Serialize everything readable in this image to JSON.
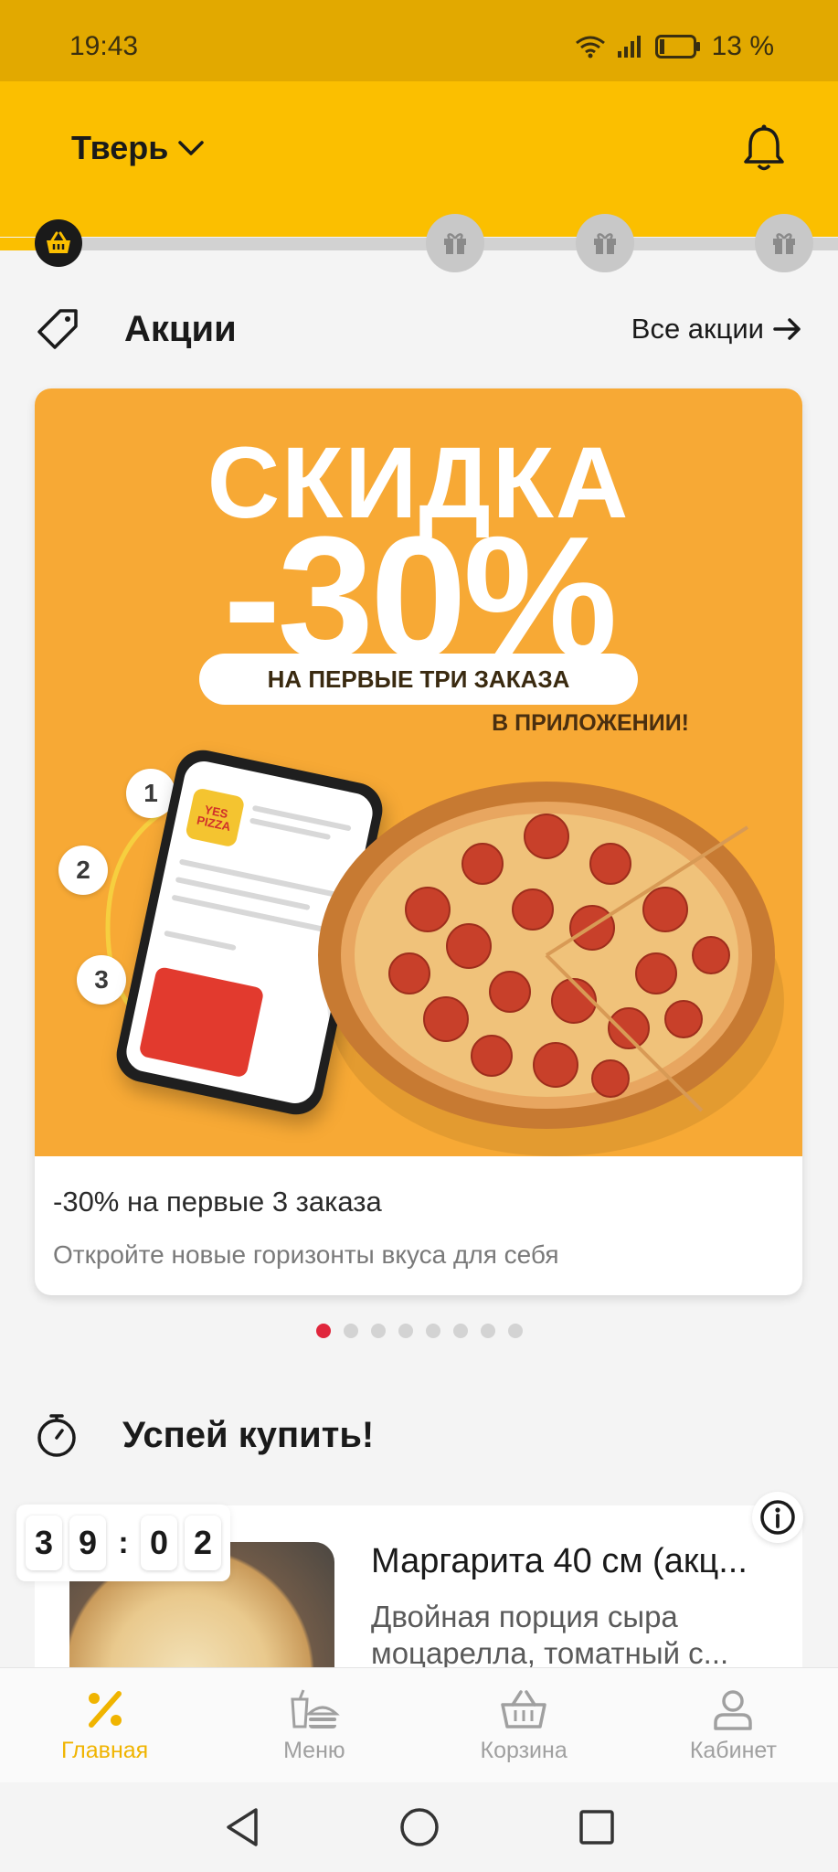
{
  "status_bar": {
    "time": "19:43",
    "battery": "13 %"
  },
  "header": {
    "city": "Тверь"
  },
  "bonus_progress": {
    "fill_fraction": 0.06
  },
  "promotions": {
    "title": "Акции",
    "all_link": "Все акции",
    "card": {
      "banner_line1": "СКИДКА",
      "banner_line2": "-30%",
      "banner_pill": "НА ПЕРВЫЕ ТРИ ЗАКАЗА",
      "banner_line3": "В ПРИЛОЖЕНИИ!",
      "steps": [
        "1",
        "2",
        "3"
      ],
      "phone_logo": "YES PIZZA",
      "title": "-30% на первые 3 заказа",
      "subtitle": "Откройте новые горизонты вкуса для себя"
    },
    "pager": {
      "count": 8,
      "active": 0
    }
  },
  "hurry": {
    "title": "Успей купить!",
    "timer": {
      "d1": "3",
      "d2": "9",
      "sep": ":",
      "d3": "0",
      "d4": "2"
    },
    "product": {
      "title": "Маргарита 40 см (акц...",
      "description": "Двойная порция сыра моцарелла, томатный с..."
    }
  },
  "bottom_nav": {
    "items": [
      {
        "label": "Главная",
        "icon": "percent-icon",
        "active": true
      },
      {
        "label": "Меню",
        "icon": "burger-icon",
        "active": false
      },
      {
        "label": "Корзина",
        "icon": "basket-icon",
        "active": false
      },
      {
        "label": "Кабинет",
        "icon": "user-icon",
        "active": false
      }
    ]
  },
  "colors": {
    "brand_yellow": "#fbbf00",
    "status_yellow": "#e2a900",
    "banner_orange": "#f7a935",
    "pager_active": "#e0263c"
  }
}
